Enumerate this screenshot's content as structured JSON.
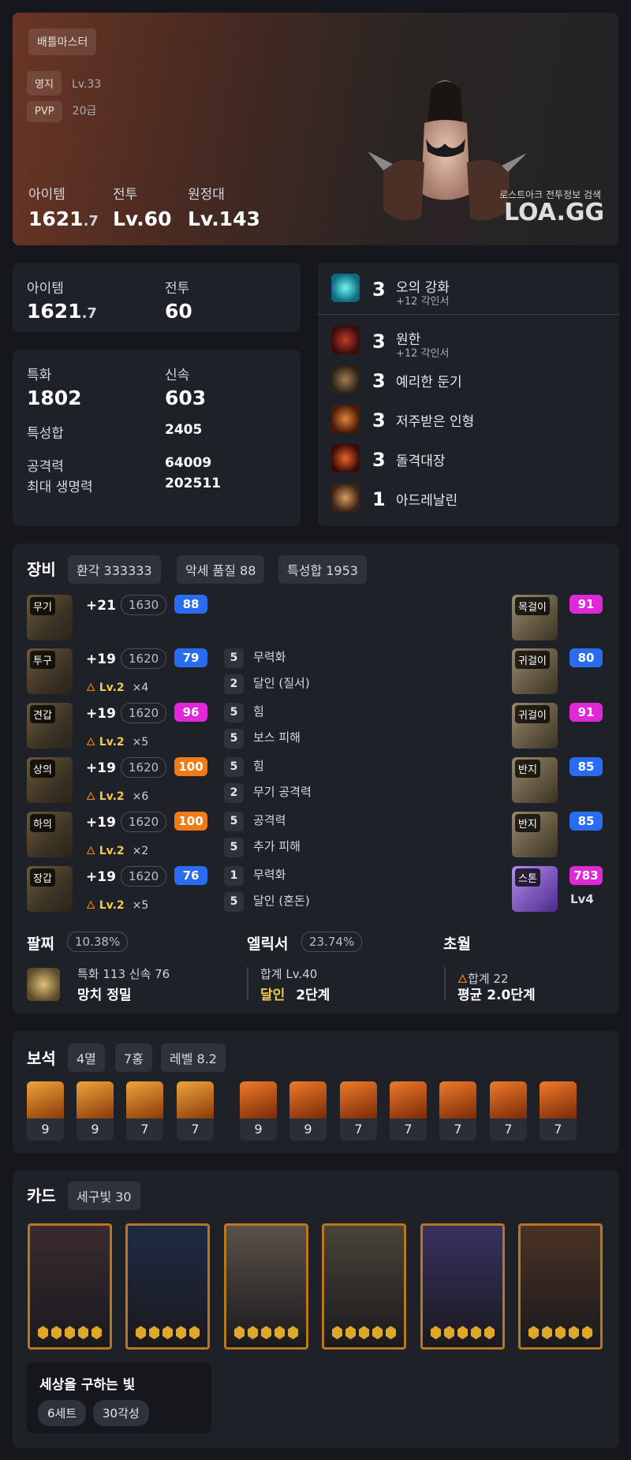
{
  "hero": {
    "class_tag": "배틀마스터",
    "rows": [
      {
        "label": "영지",
        "value": "Lv.33"
      },
      {
        "label": "PVP",
        "value": "20급"
      }
    ],
    "stats": [
      {
        "label": "아이템",
        "value": "1621",
        "sub": ".7"
      },
      {
        "label": "전투",
        "value": "Lv.60",
        "sub": ""
      },
      {
        "label": "원정대",
        "value": "Lv.143",
        "sub": ""
      }
    ],
    "watermark_caption": "로스트아크 전투정보 검색",
    "watermark_logo": "LOA.GG"
  },
  "level_card": {
    "item_label": "아이템",
    "item_value": "1621",
    "item_sub": ".7",
    "combat_label": "전투",
    "combat_value": "60"
  },
  "stats_card": {
    "spec_label": "특화",
    "spec_value": "1802",
    "swift_label": "신속",
    "swift_value": "603",
    "sum_label": "특성합",
    "sum_value": "2405",
    "atk_label": "공격력",
    "atk_value": "64009",
    "hp_label": "최대 생명력",
    "hp_value": "202511"
  },
  "engravings": {
    "top": {
      "level": "3",
      "name": "오의 강화",
      "sub": "+12 각인서",
      "color": "#29c7c0"
    },
    "list": [
      {
        "level": "3",
        "name": "원한",
        "sub": "+12 각인서",
        "color": "#7a1414"
      },
      {
        "level": "3",
        "name": "예리한 둔기",
        "sub": "",
        "color": "#6a4a2a"
      },
      {
        "level": "3",
        "name": "저주받은 인형",
        "sub": "",
        "color": "#8a3a12"
      },
      {
        "level": "3",
        "name": "돌격대장",
        "sub": "",
        "color": "#a2300a"
      },
      {
        "level": "1",
        "name": "아드레날린",
        "sub": "",
        "color": "#8a5a30"
      }
    ]
  },
  "equipment": {
    "title": "장비",
    "chips": [
      "환각 333333",
      "악세 품질 88",
      "특성합 1953"
    ],
    "armor": [
      {
        "slot": "무기",
        "upgrade": "+21",
        "ilvl": "1630",
        "quality": "88",
        "qcolor": "blue",
        "elixir": "",
        "mult": "",
        "opts": []
      },
      {
        "slot": "투구",
        "upgrade": "+19",
        "ilvl": "1620",
        "quality": "79",
        "qcolor": "blue",
        "elixir": "Lv.2",
        "mult": "×4",
        "opts": [
          {
            "n": "5",
            "t": "무력화"
          },
          {
            "n": "2",
            "t": "달인 (질서)"
          }
        ]
      },
      {
        "slot": "견갑",
        "upgrade": "+19",
        "ilvl": "1620",
        "quality": "96",
        "qcolor": "pink",
        "elixir": "Lv.2",
        "mult": "×5",
        "opts": [
          {
            "n": "5",
            "t": "힘"
          },
          {
            "n": "5",
            "t": "보스 피해"
          }
        ]
      },
      {
        "slot": "상의",
        "upgrade": "+19",
        "ilvl": "1620",
        "quality": "100",
        "qcolor": "orange",
        "elixir": "Lv.2",
        "mult": "×6",
        "opts": [
          {
            "n": "5",
            "t": "힘"
          },
          {
            "n": "2",
            "t": "무기 공격력"
          }
        ]
      },
      {
        "slot": "하의",
        "upgrade": "+19",
        "ilvl": "1620",
        "quality": "100",
        "qcolor": "orange",
        "elixir": "Lv.2",
        "mult": "×2",
        "opts": [
          {
            "n": "5",
            "t": "공격력"
          },
          {
            "n": "5",
            "t": "추가 피해"
          }
        ]
      },
      {
        "slot": "장갑",
        "upgrade": "+19",
        "ilvl": "1620",
        "quality": "76",
        "qcolor": "blue",
        "elixir": "Lv.2",
        "mult": "×5",
        "opts": [
          {
            "n": "1",
            "t": "무력화"
          },
          {
            "n": "5",
            "t": "달인 (혼돈)"
          }
        ]
      }
    ],
    "accessories": [
      {
        "slot": "목걸이",
        "quality": "91",
        "qcolor": "pink",
        "extra": ""
      },
      {
        "slot": "귀걸이",
        "quality": "80",
        "qcolor": "blue",
        "extra": ""
      },
      {
        "slot": "귀걸이",
        "quality": "91",
        "qcolor": "pink",
        "extra": ""
      },
      {
        "slot": "반지",
        "quality": "85",
        "qcolor": "blue",
        "extra": ""
      },
      {
        "slot": "반지",
        "quality": "85",
        "qcolor": "blue",
        "extra": ""
      },
      {
        "slot": "스톤",
        "quality": "783",
        "qcolor": "pink",
        "extra": "Lv4"
      }
    ],
    "bracelet": {
      "title": "팔찌",
      "pct": "10.38%",
      "line1": "특화 113  신속 76",
      "line2": "망치  정밀"
    },
    "elixir": {
      "title": "엘릭서",
      "pct": "23.74%",
      "line1": "합계 Lv.40",
      "line2a": "달인",
      "line2b": "2단계"
    },
    "transcend": {
      "title": "초월",
      "line1": "합계 22",
      "line2": "평균 2.0단계"
    }
  },
  "gems": {
    "title": "보석",
    "chips": [
      "4멸",
      "7홍",
      "레벨 8.2"
    ],
    "levels": [
      "9",
      "9",
      "7",
      "7",
      "9",
      "9",
      "7",
      "7",
      "7",
      "7",
      "7"
    ]
  },
  "cards": {
    "title": "카드",
    "chip": "세구빛 30",
    "set_name": "세상을 구하는 빛",
    "set_tags": [
      "6세트",
      "30각성"
    ],
    "colors": [
      "#3a2a30",
      "#1e2a44",
      "#5a5048",
      "#4a4438",
      "#3a3060",
      "#4a3224"
    ]
  }
}
